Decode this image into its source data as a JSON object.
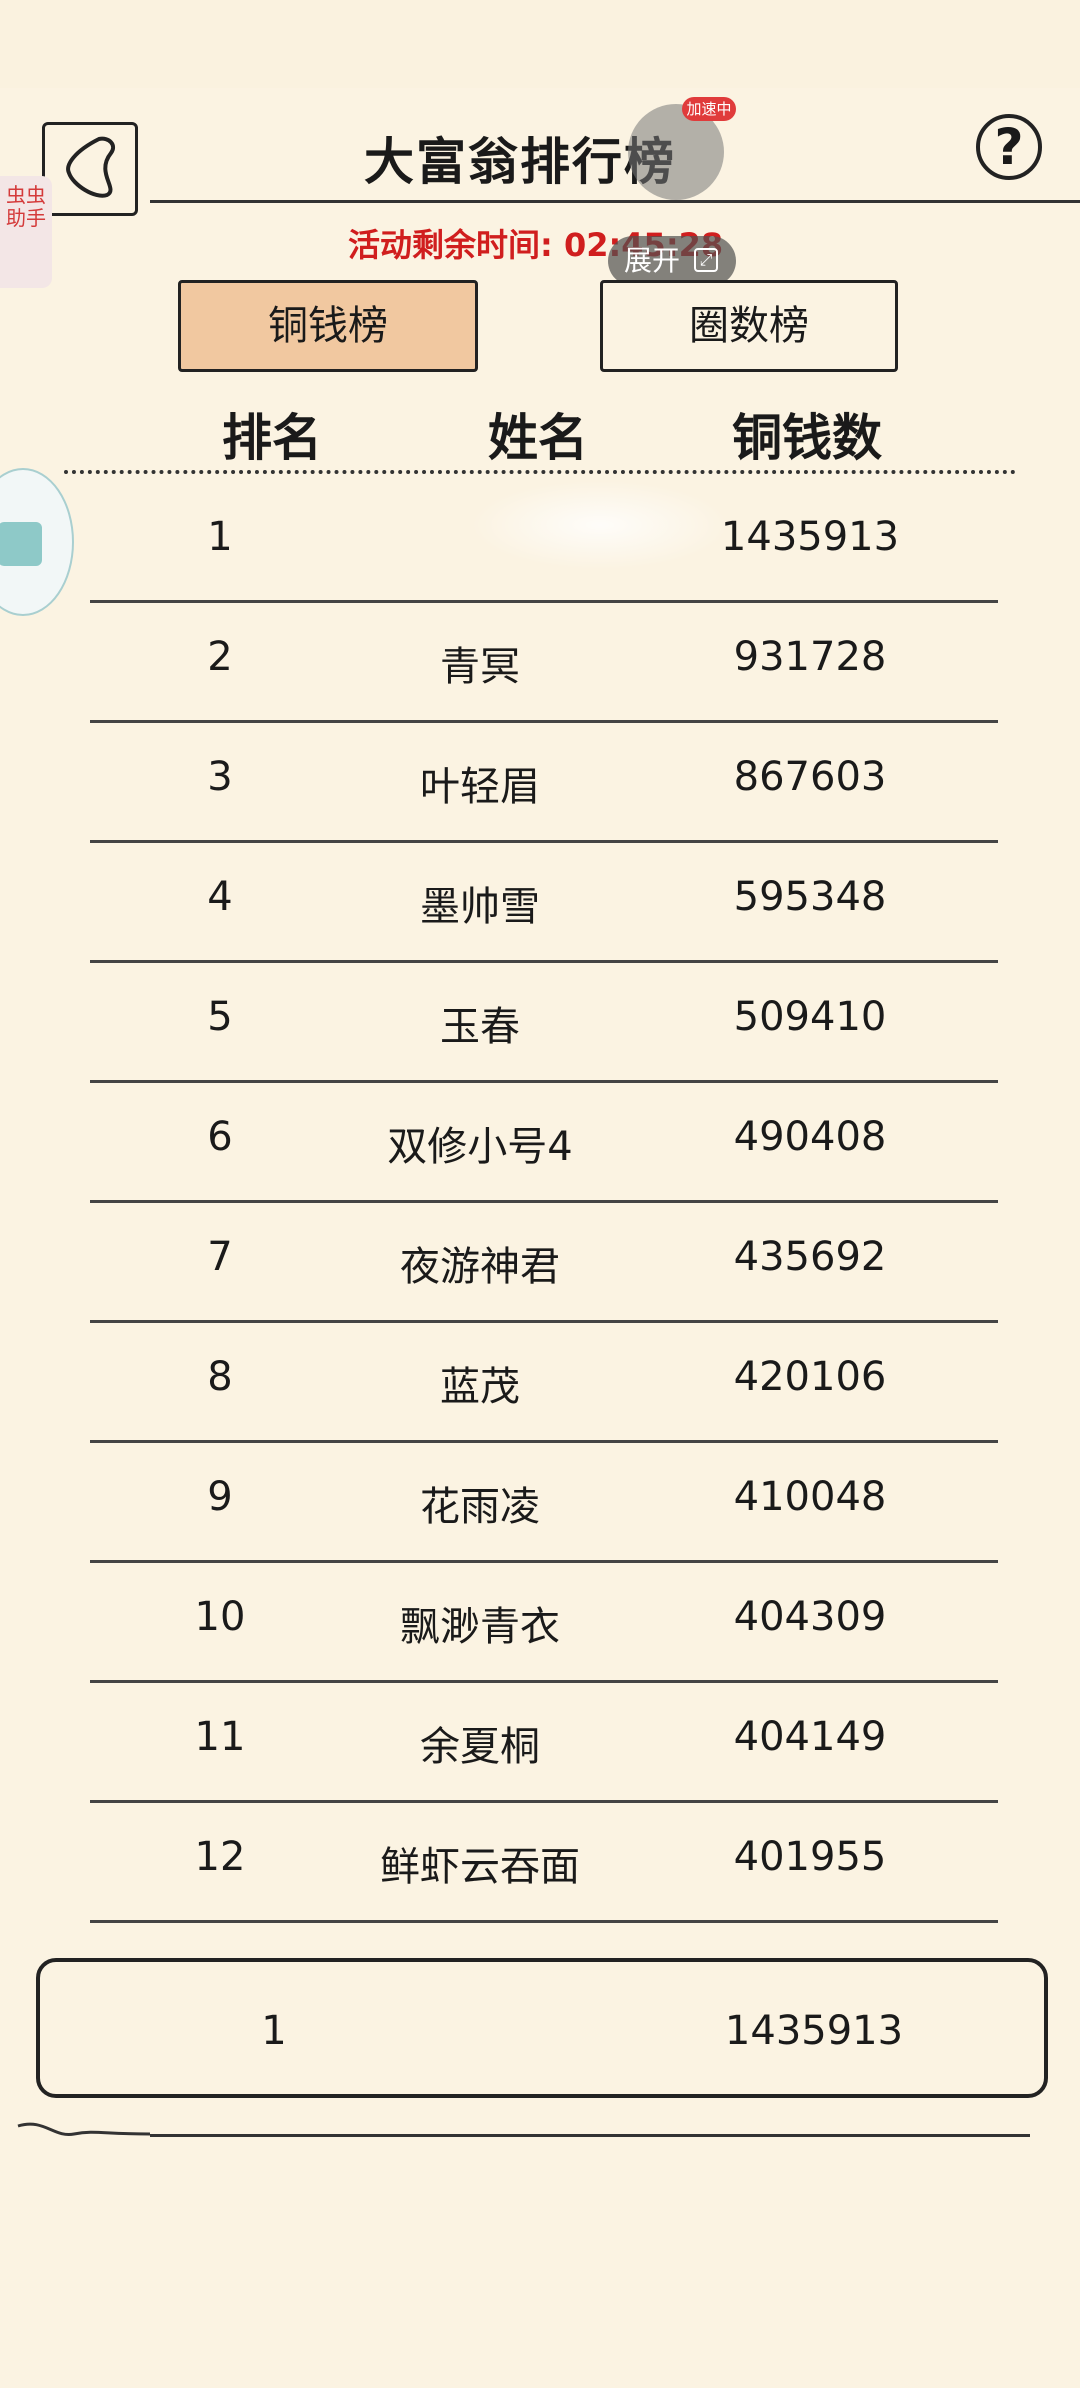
{
  "header": {
    "title": "大富翁排行榜",
    "help_label": "?"
  },
  "timer": {
    "label": "活动剩余时间:",
    "value": "02:45:28"
  },
  "overlay": {
    "speed_badge": "加速中",
    "expand_label": "展开",
    "side_tab": "虫虫助手"
  },
  "tabs": [
    {
      "label": "铜钱榜",
      "active": true
    },
    {
      "label": "圈数榜",
      "active": false
    }
  ],
  "columns": {
    "rank": "排名",
    "name": "姓名",
    "coins": "铜钱数"
  },
  "rows": [
    {
      "rank": "1",
      "name": "",
      "coins": "1435913"
    },
    {
      "rank": "2",
      "name": "青冥",
      "coins": "931728"
    },
    {
      "rank": "3",
      "name": "叶轻眉",
      "coins": "867603"
    },
    {
      "rank": "4",
      "name": "墨帅雪",
      "coins": "595348"
    },
    {
      "rank": "5",
      "name": "玉春",
      "coins": "509410"
    },
    {
      "rank": "6",
      "name": "双修小号4",
      "coins": "490408"
    },
    {
      "rank": "7",
      "name": "夜游神君",
      "coins": "435692"
    },
    {
      "rank": "8",
      "name": "蓝茂",
      "coins": "420106"
    },
    {
      "rank": "9",
      "name": "花雨凌",
      "coins": "410048"
    },
    {
      "rank": "10",
      "name": "飘渺青衣",
      "coins": "404309"
    },
    {
      "rank": "11",
      "name": "余夏桐",
      "coins": "404149"
    },
    {
      "rank": "12",
      "name": "鲜虾云吞面",
      "coins": "401955"
    }
  ],
  "my_rank": {
    "rank": "1",
    "name": "",
    "coins": "1435913"
  },
  "colors": {
    "background": "#fbf3e2",
    "active_tab": "#f1c8a0",
    "timer_red": "#d01e1e"
  }
}
